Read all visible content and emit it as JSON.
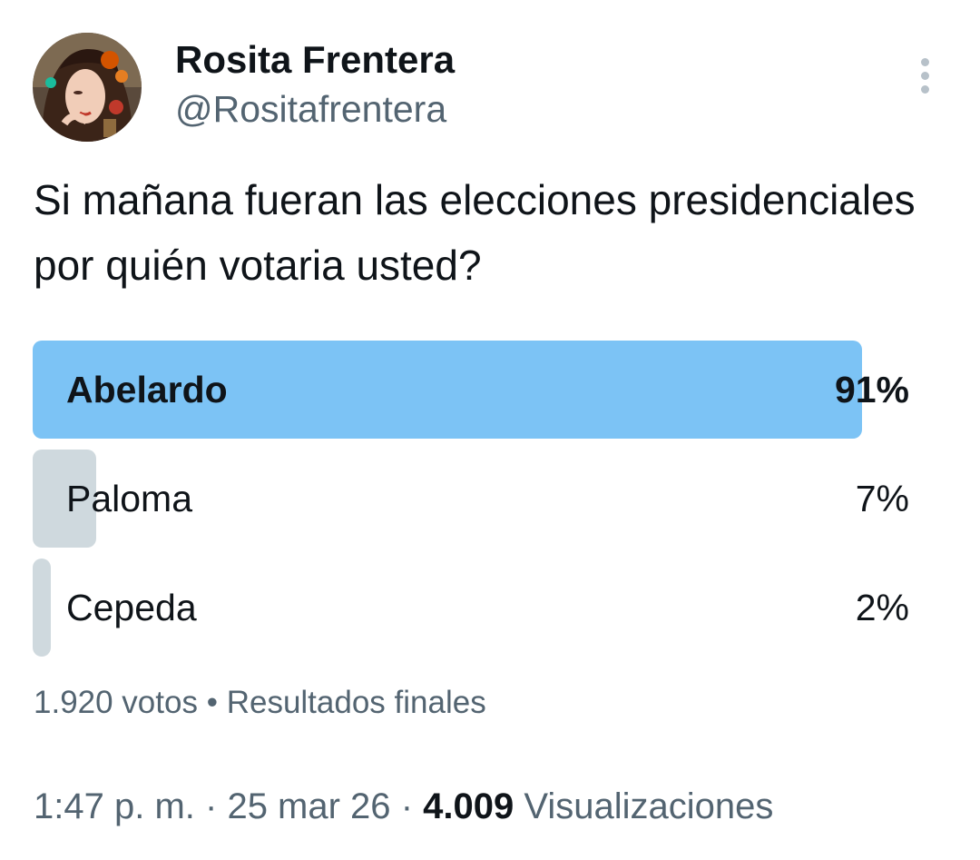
{
  "author": {
    "display_name": "Rosita Frentera",
    "handle": "@Rositafrentera"
  },
  "tweet": {
    "text": "Si mañana fueran las elecciones presidenciales por quién votaria usted?"
  },
  "poll": {
    "options": [
      {
        "label": "Abelardo",
        "percent_text": "91%",
        "percent": 91,
        "winner": true
      },
      {
        "label": "Paloma",
        "percent_text": "7%",
        "percent": 7,
        "winner": false
      },
      {
        "label": "Cepeda",
        "percent_text": "2%",
        "percent": 2,
        "winner": false
      }
    ],
    "votes": "1.920 votos",
    "separator": "•",
    "status": "Resultados finales"
  },
  "meta": {
    "time": "1:47 p. m.",
    "date": "25 mar 26",
    "separator": "·",
    "views_count": "4.009",
    "views_label": "Visualizaciones"
  },
  "icons": {
    "more": "more-vertical-icon"
  },
  "colors": {
    "winner_bar": "#7cc3f5",
    "other_bar": "#cfd9de",
    "secondary_text": "#536471",
    "primary_text": "#0f1419"
  }
}
